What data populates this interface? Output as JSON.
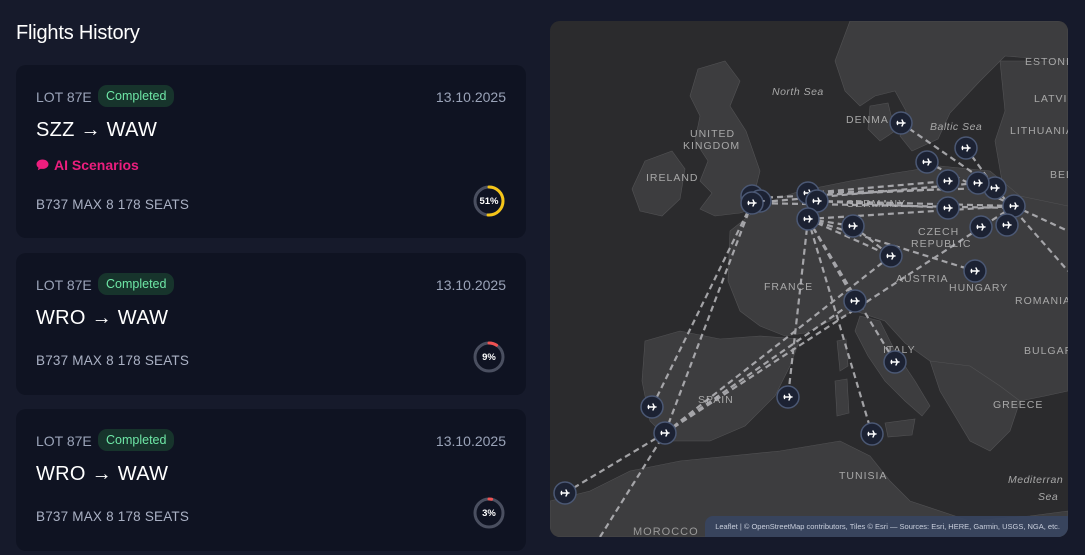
{
  "page": {
    "title": "Flights History"
  },
  "flights": [
    {
      "code": "LOT 87E",
      "status": "Completed",
      "date": "13.10.2025",
      "route": "SZZ → WAW",
      "ai_label": "AI Scenarios",
      "aircraft": "B737 MAX 8 178 SEATS",
      "progress": 51,
      "progress_label": "51%",
      "progress_color": "#f5c518"
    },
    {
      "code": "LOT 87E",
      "status": "Completed",
      "date": "13.10.2025",
      "route": "WRO → WAW",
      "aircraft": "B737 MAX 8 178 SEATS",
      "progress": 9,
      "progress_label": "9%",
      "progress_color": "#f05252"
    },
    {
      "code": "LOT 87E",
      "status": "Completed",
      "date": "13.10.2025",
      "route": "WRO → WAW",
      "aircraft": "B737 MAX 8 178 SEATS",
      "progress": 3,
      "progress_label": "3%",
      "progress_color": "#f05252"
    }
  ],
  "map": {
    "labels": {
      "north_sea": "North Sea",
      "uk": "UNITED",
      "uk2": "KINGDOM",
      "ireland": "IRELAND",
      "denmark": "DENMA",
      "baltic": "Baltic Sea",
      "estonia": "ESTONI",
      "latvia": "LATVI",
      "lithuania": "LITHUANIA",
      "belarus": "BEL",
      "germany": "GERMANY",
      "czech": "CZECH",
      "czech2": "REPUBLIC",
      "austria": "AUSTRIA",
      "hungary": "HUNGARY",
      "romania": "ROMANIA",
      "france": "FRANCE",
      "italy": "ITALY",
      "bulgaria": "BULGAR",
      "spain": "SPAIN",
      "greece": "GREECE",
      "tunisia": "TUNISIA",
      "med": "Mediterran",
      "med2": "Sea",
      "morocco": "MOROCCO"
    },
    "attribution": "Leaflet | © OpenStreetMap contributors, Tiles © Esri — Sources: Esri, HERE, Garmin, USGS, NGA, etc.",
    "marker_icon": "airplane-icon"
  }
}
